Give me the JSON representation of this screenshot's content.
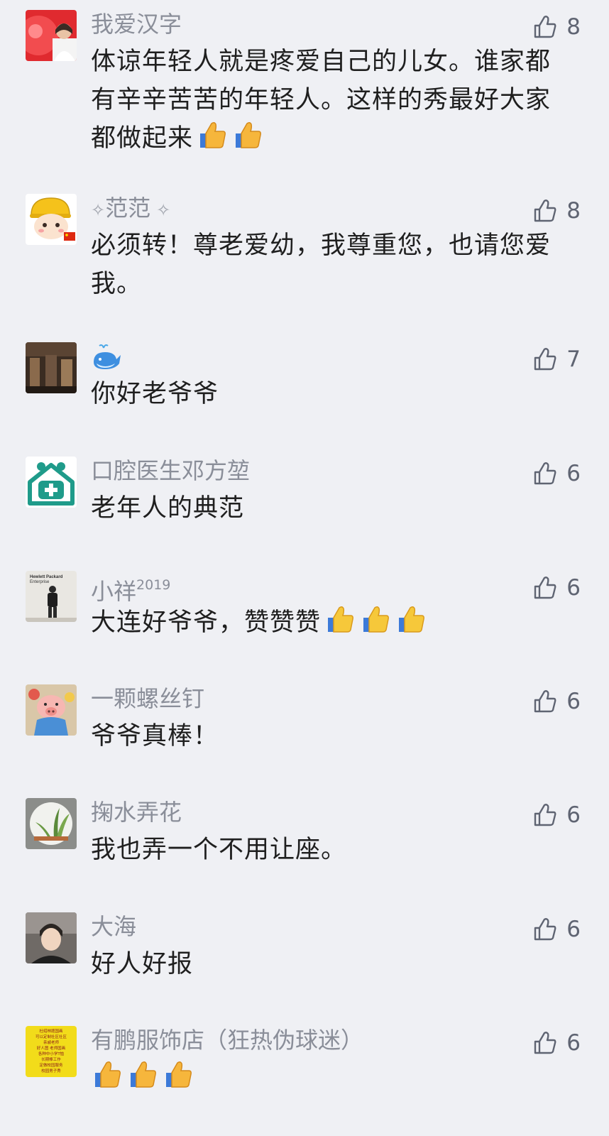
{
  "comments": [
    {
      "name": "我爱汉字",
      "likes": "8",
      "text": "体谅年轻人就是疼爱自己的儿女。谁家都有辛辛苦苦的年轻人。这样的秀最好大家都做起来",
      "emoji": "thumbs-up-emoji x2"
    },
    {
      "name": "范范",
      "likes": "8",
      "text": "必须转！尊老爱幼，我尊重您，也请您爱我。"
    },
    {
      "name_icon": "whale-icon",
      "likes": "7",
      "text": "你好老爷爷"
    },
    {
      "name": "口腔医生邓方堃",
      "likes": "6",
      "text": "老年人的典范"
    },
    {
      "name": "小祥",
      "name_sup": "2019",
      "likes": "6",
      "text": "大连好爷爷，赞赞赞",
      "emoji": "thumbs-up-emoji x3"
    },
    {
      "name": "一颗螺丝钉",
      "likes": "6",
      "text": "爷爷真棒！"
    },
    {
      "name": "掬水弄花",
      "likes": "6",
      "text": "我也弄一个不用让座。"
    },
    {
      "name": "大海",
      "likes": "6",
      "text": "好人好报"
    },
    {
      "name": "有鹏服饰店（狂热伪球迷）",
      "likes": "6",
      "text": "",
      "emoji": "thumbs-up-emoji x3"
    }
  ],
  "avatar_text": {
    "hpe_sign_line1": "Hewlett Packard",
    "hpe_sign_line2": "Enterprise",
    "yellow_sign_lines": [
      "杜绍林题国画",
      "可以定制社区社区",
      "亲戚老师",
      "好人图 老师国画",
      "各种中小学T恤",
      "长期棒工作",
      "定做校园服务",
      "校园男子秀"
    ]
  },
  "colors": {
    "background": "#eff0f4",
    "name_text": "#8a8e99",
    "body_text": "#1f1f1f",
    "like_icon": "#5f6472",
    "emoji_yellow": "#f6b63c",
    "cuff_blue": "#3c7ad8"
  }
}
